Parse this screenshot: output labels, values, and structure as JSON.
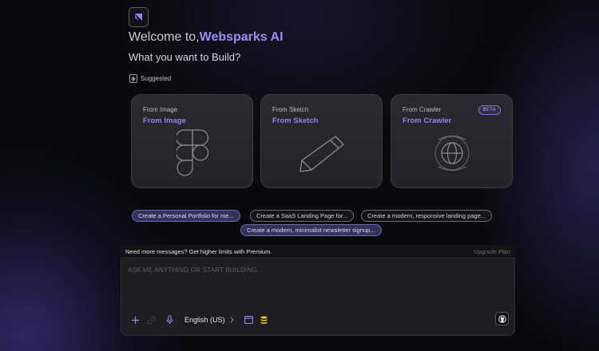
{
  "header": {
    "welcome_prefix": "Welcome to,",
    "brand": "Websparks AI",
    "subtitle": "What you want to Build?"
  },
  "suggested_label": "Suggested",
  "cards": [
    {
      "caption": "From Image",
      "title": "From Image",
      "icon": "figma-icon"
    },
    {
      "caption": "From Sketch",
      "title": "From Sketch",
      "icon": "pencil-icon"
    },
    {
      "caption": "From Crawler",
      "title": "From Crawler",
      "icon": "globe-icon",
      "badge": "BETA"
    }
  ],
  "prompt_chips": [
    "Create a Personal Portfolio for me...",
    "Create a SaaS Landing Page for...",
    "Create a modern, responsive landing page...",
    "Create a modern, minimalist newsletter signup..."
  ],
  "banner": {
    "message": "Need more messages? Get higher limits with Premium.",
    "upgrade": "Upgrade Plan"
  },
  "composer": {
    "placeholder": "ASK ME ANYTHING OR START BUILDING...",
    "language": "English (US)"
  },
  "colors": {
    "accent": "#9a8cf0",
    "background": "#0a0a0d",
    "card": "#2a2a30"
  }
}
